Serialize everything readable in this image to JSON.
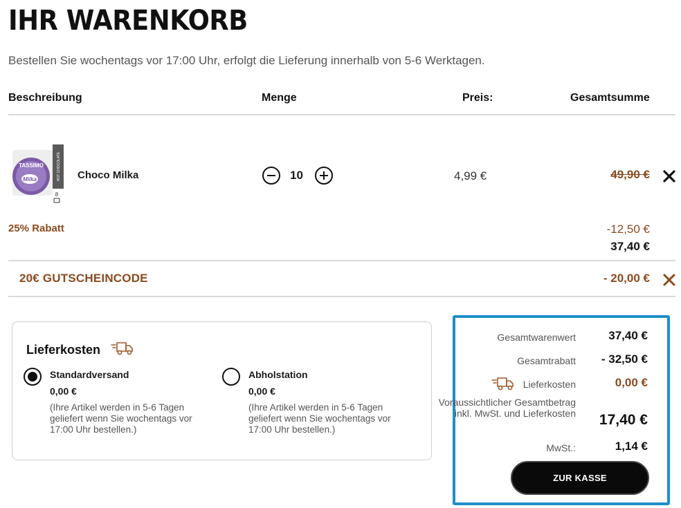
{
  "header": {
    "title": "IHR WARENKORB",
    "subtitle": "Bestellen Sie wochentags vor 17:00 Uhr, erfolgt die Lieferung innerhalb von 5-6 Werktagen."
  },
  "table": {
    "columns": [
      "Beschreibung",
      "Menge",
      "Preis:",
      "Gesamtsumme"
    ]
  },
  "item": {
    "name": "Choco Milka",
    "quantity": "10",
    "price": "4,99 €",
    "total_original": "49,90 €",
    "image_brand": "TASSIMO",
    "image_product": "Milka",
    "image_side": "HOT CHOCOLATE",
    "image_count": "8",
    "discount_label": "25% Rabatt",
    "discount_amount": "-12,50 €",
    "total_discounted": "37,40 €"
  },
  "voucher": {
    "label": "20€ GUTSCHEINCODE",
    "amount": "- 20,00 €"
  },
  "shipping": {
    "title": "Lieferkosten",
    "options": [
      {
        "name": "Standardversand",
        "price": "0,00 €",
        "note": "(Ihre Artikel werden in 5-6 Tagen geliefert wenn Sie wochentags vor 17:00 Uhr bestellen.)",
        "selected": true
      },
      {
        "name": "Abholstation",
        "price": "0,00 €",
        "note": "(Ihre Artikel werden in 5-6 Tagen geliefert wenn Sie wochentags vor 17:00 Uhr bestellen.)",
        "selected": false
      }
    ]
  },
  "summary": {
    "goods_label": "Gesamtwarenwert",
    "goods_value": "37,40 €",
    "discount_label": "Gesamtrabatt",
    "discount_value": "- 32,50 €",
    "shipping_label": "Lieferkosten",
    "shipping_value": "0,00 €",
    "total_label": "Voraussichtlicher Gesamtbetrag inkl. MwSt. und Lieferkosten",
    "total_value": "17,40 €",
    "vat_label": "MwSt.:",
    "vat_value": "1,14 €",
    "checkout_label": "ZUR KASSE"
  },
  "colors": {
    "accent_brown": "#8a4b1f",
    "summary_border": "#1d8fc9",
    "button_bg": "#0a0a0a"
  },
  "icons": {
    "truck": "delivery-truck-icon",
    "remove": "close-icon",
    "minus": "minus-circle-icon",
    "plus": "plus-circle-icon"
  }
}
